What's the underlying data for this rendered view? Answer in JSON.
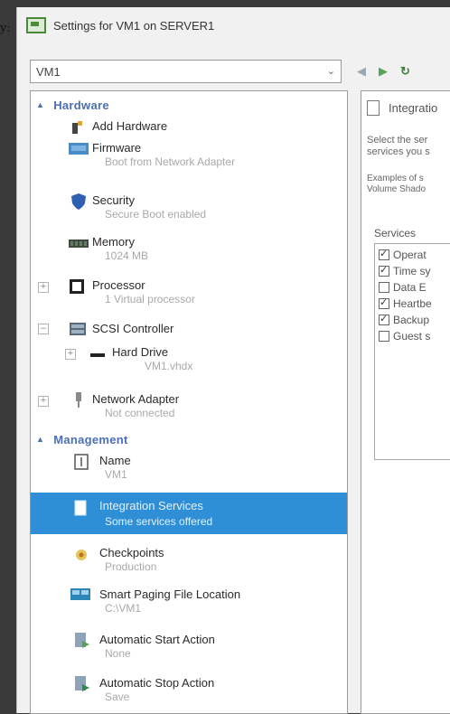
{
  "prefix": "y:",
  "window": {
    "title": "Settings for VM1 on SERVER1"
  },
  "vm_selector": {
    "value": "VM1"
  },
  "hardware": {
    "header": "Hardware",
    "items": [
      {
        "label": "Add Hardware",
        "sub": "",
        "icon": "add-hardware-icon"
      },
      {
        "label": "Firmware",
        "sub": "Boot from Network Adapter",
        "icon": "firmware-icon"
      },
      {
        "label": "Security",
        "sub": "Secure Boot enabled",
        "icon": "shield-icon"
      },
      {
        "label": "Memory",
        "sub": "1024 MB",
        "icon": "memory-icon"
      },
      {
        "label": "Processor",
        "sub": "1 Virtual processor",
        "icon": "processor-icon"
      },
      {
        "label": "SCSI Controller",
        "sub": "",
        "icon": "scsi-controller-icon"
      },
      {
        "label": "Hard Drive",
        "sub": "VM1.vhdx",
        "icon": "hard-drive-icon"
      },
      {
        "label": "Network Adapter",
        "sub": "Not connected",
        "icon": "network-adapter-icon"
      }
    ]
  },
  "management": {
    "header": "Management",
    "items": [
      {
        "label": "Name",
        "sub": "VM1",
        "icon": "name-icon"
      },
      {
        "label": "Integration Services",
        "sub": "Some services offered",
        "icon": "integration-services-icon"
      },
      {
        "label": "Checkpoints",
        "sub": "Production",
        "icon": "checkpoints-icon"
      },
      {
        "label": "Smart Paging File Location",
        "sub": "C:\\VM1",
        "icon": "smart-paging-icon"
      },
      {
        "label": "Automatic Start Action",
        "sub": "None",
        "icon": "auto-start-icon"
      },
      {
        "label": "Automatic Stop Action",
        "sub": "Save",
        "icon": "auto-stop-icon"
      }
    ]
  },
  "right_panel": {
    "title": "Integratio",
    "desc_line1": "Select the ser",
    "desc_line2": "services you s",
    "examples_line1": "Examples of s",
    "examples_line2": "Volume Shado",
    "services_label": "Services",
    "services": [
      {
        "label": "Operat",
        "checked": true
      },
      {
        "label": "Time sy",
        "checked": true
      },
      {
        "label": "Data E",
        "checked": false
      },
      {
        "label": "Heartbe",
        "checked": true
      },
      {
        "label": "Backup",
        "checked": true
      },
      {
        "label": "Guest s",
        "checked": false
      }
    ]
  },
  "colors": {
    "selection": "#2f8fd6",
    "section_header": "#4b6fb5"
  }
}
